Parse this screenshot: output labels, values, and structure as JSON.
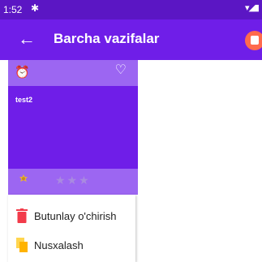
{
  "status_bar": {
    "time": "1:52",
    "gear_icon": "gear-icon",
    "right_icons": "wifi-signal-battery"
  },
  "app_bar": {
    "back_icon": "arrow-left",
    "title": "Barcha vazifalar",
    "action_icon": "trash-icon",
    "accent": "#ff6a4d"
  },
  "colors": {
    "primary_dark": "#5b16c4",
    "primary": "#6f1ee8",
    "card_light": "#9c66f2"
  },
  "card": {
    "title": "test2",
    "alarm_icon": "alarm-icon",
    "favorite_icon": "heart-outline-icon",
    "priority_icon": "priority-icon",
    "rating": 0,
    "rating_max": 3
  },
  "context_menu": {
    "items": [
      {
        "label": "Butunlay o'chirish",
        "icon": "trash-icon",
        "color": "#f23b4a"
      },
      {
        "label": "Nusxalash",
        "icon": "copy-icon",
        "color": "#ffc107"
      }
    ]
  }
}
